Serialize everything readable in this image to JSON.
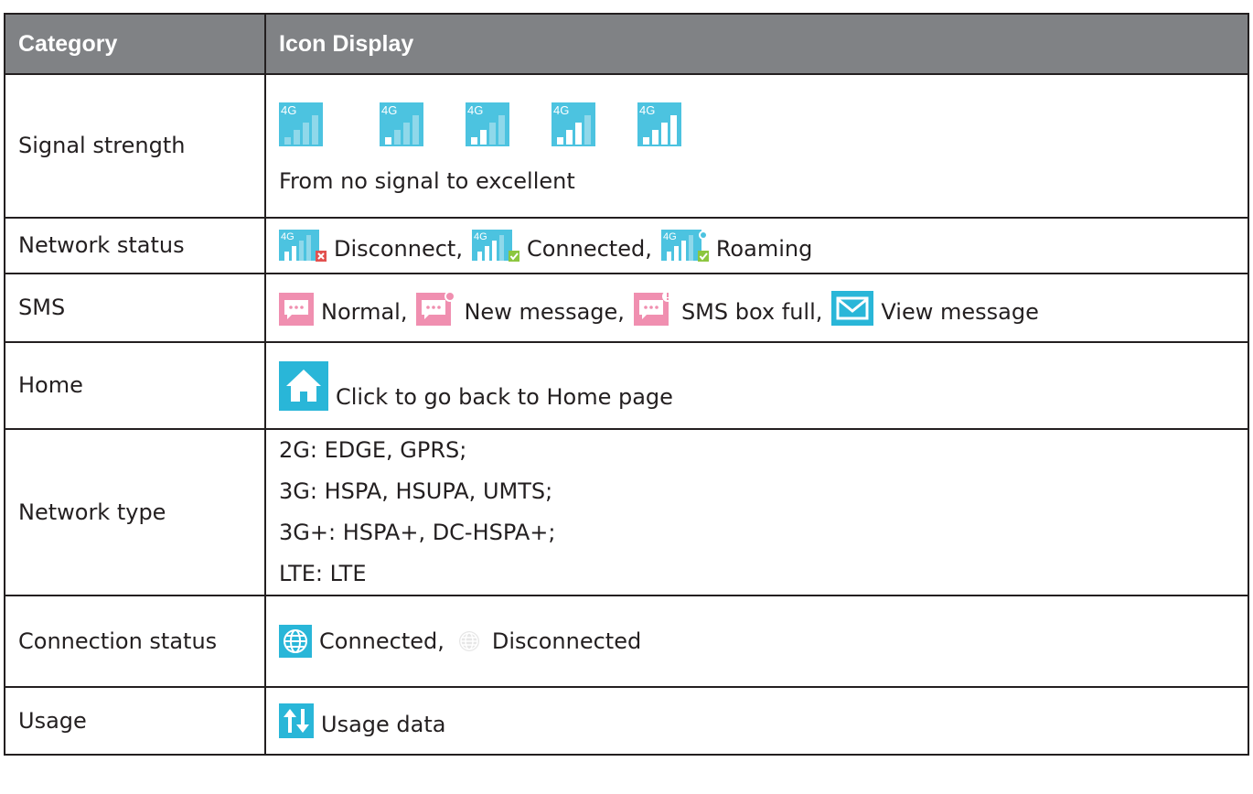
{
  "table": {
    "headers": {
      "category": "Category",
      "icon_display": "Icon Display"
    },
    "signal": {
      "category": "Signal strength",
      "icon_label": "4G",
      "levels": [
        0,
        1,
        2,
        3,
        4
      ],
      "caption": "From no signal to excellent"
    },
    "network_status": {
      "category": "Network status",
      "icon_label": "4G",
      "disconnect": "Disconnect,",
      "connected": "Connected,",
      "roaming": "Roaming"
    },
    "sms": {
      "category": "SMS",
      "normal": "Normal,",
      "new_message": "New message,",
      "box_full": "SMS box full,",
      "view_message": "View message"
    },
    "home": {
      "category": "Home",
      "description": "Click to go back to Home page"
    },
    "network_type": {
      "category": "Network type",
      "lines": [
        "2G: EDGE, GPRS;",
        "3G: HSPA, HSUPA, UMTS;",
        "3G+: HSPA+, DC-HSPA+;",
        "LTE: LTE"
      ]
    },
    "connection": {
      "category": "Connection status",
      "connected": "Connected,",
      "disconnected": "Disconnected"
    },
    "usage": {
      "category": "Usage",
      "description": "Usage data"
    }
  },
  "colors": {
    "header_bg": "#808285",
    "icon_cyan": "#29b6d8",
    "sms_pink": "#f08fb0",
    "error_red": "#e2514f",
    "ok_green": "#8cc63f"
  },
  "icons": [
    "signal-4g-icon",
    "sms-icon",
    "envelope-icon",
    "home-icon",
    "globe-icon",
    "usage-arrows-icon"
  ]
}
